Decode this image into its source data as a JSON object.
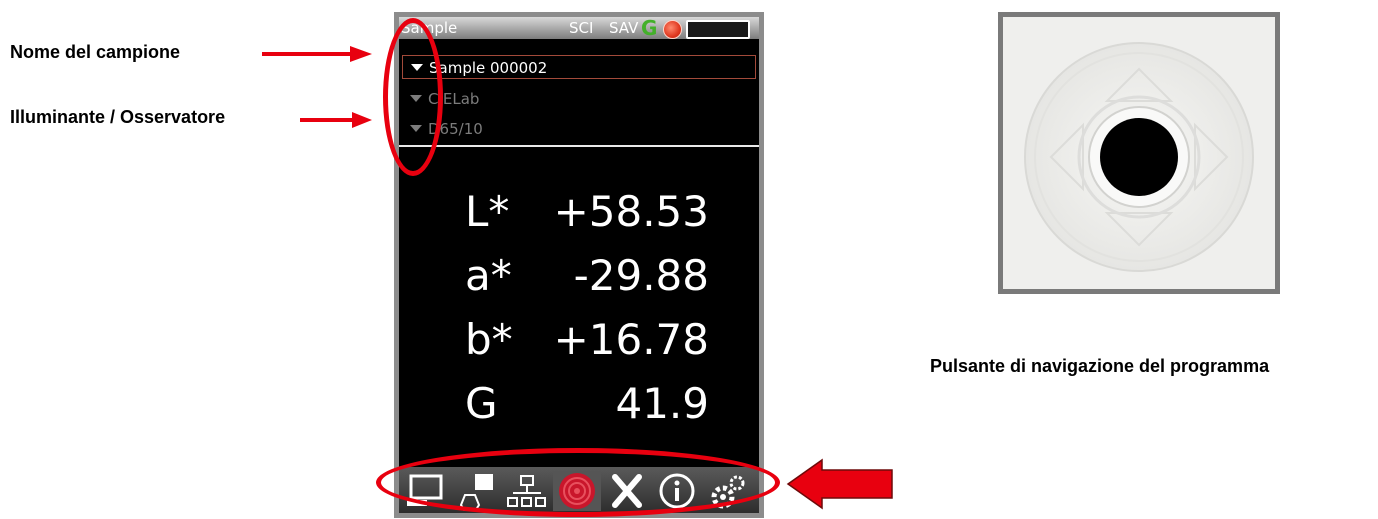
{
  "annotations": {
    "sample_name": "Nome del campione",
    "illuminant_observer": "Illuminante / Osservatore",
    "nav_button": "Pulsante di navigazione del programma"
  },
  "device": {
    "status_bar": {
      "mode": "Sample",
      "spec": "SCI",
      "save": "SAV",
      "g_indicator": "G"
    },
    "dropdowns": [
      {
        "label": "Sample 000002",
        "state": "active"
      },
      {
        "label": "CIELab",
        "state": "dim"
      },
      {
        "label": "D65/10",
        "state": "dim"
      }
    ],
    "readings": [
      {
        "label": "L*",
        "value": "+58.53"
      },
      {
        "label": "a*",
        "value": "-29.88"
      },
      {
        "label": "b*",
        "value": "+16.78"
      },
      {
        "label": "G",
        "value": "41.9"
      }
    ],
    "toolbar": [
      {
        "icon": "display-icon"
      },
      {
        "icon": "shapes-icon"
      },
      {
        "icon": "hierarchy-icon"
      },
      {
        "icon": "target-icon",
        "selected": true
      },
      {
        "icon": "tools-icon"
      },
      {
        "icon": "info-icon"
      },
      {
        "icon": "settings-icon"
      }
    ]
  },
  "colors": {
    "highlight_red": "#e8000f",
    "status_green": "#43b02a",
    "led_red": "#e0381f"
  }
}
